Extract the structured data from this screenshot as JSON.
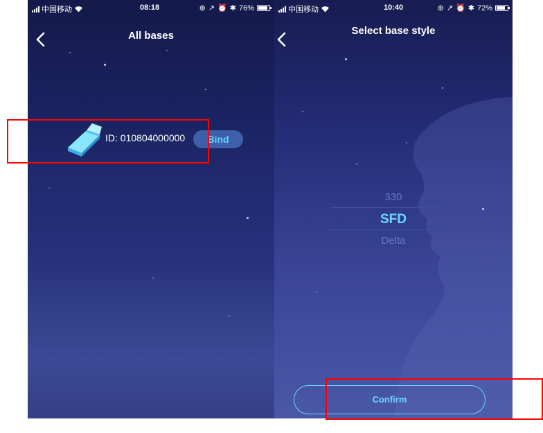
{
  "left_screen": {
    "status_bar": {
      "carrier": "中国移动",
      "time": "08:18",
      "battery": "76%",
      "battery_level": 0.76
    },
    "nav": {
      "title": "All bases"
    },
    "base_item": {
      "id_text": "ID: 010804000000",
      "bind_label": "Bind"
    }
  },
  "right_screen": {
    "status_bar": {
      "carrier": "中国移动",
      "time": "10:40",
      "battery": "72%",
      "battery_level": 0.72
    },
    "nav": {
      "title": "Select base style"
    },
    "picker": {
      "options": [
        "330",
        "SFD",
        "Delta"
      ],
      "selected": "SFD"
    },
    "confirm_label": "Confirm"
  },
  "colors": {
    "accent": "#6ed6ff",
    "highlight": "#ff0000",
    "bind_bg": "#3e5fa9"
  },
  "icons": [
    "back-chevron-icon",
    "signal-bars-icon",
    "wifi-icon",
    "location-icon",
    "alarm-icon",
    "bluetooth-icon",
    "battery-icon",
    "bed-icon"
  ]
}
